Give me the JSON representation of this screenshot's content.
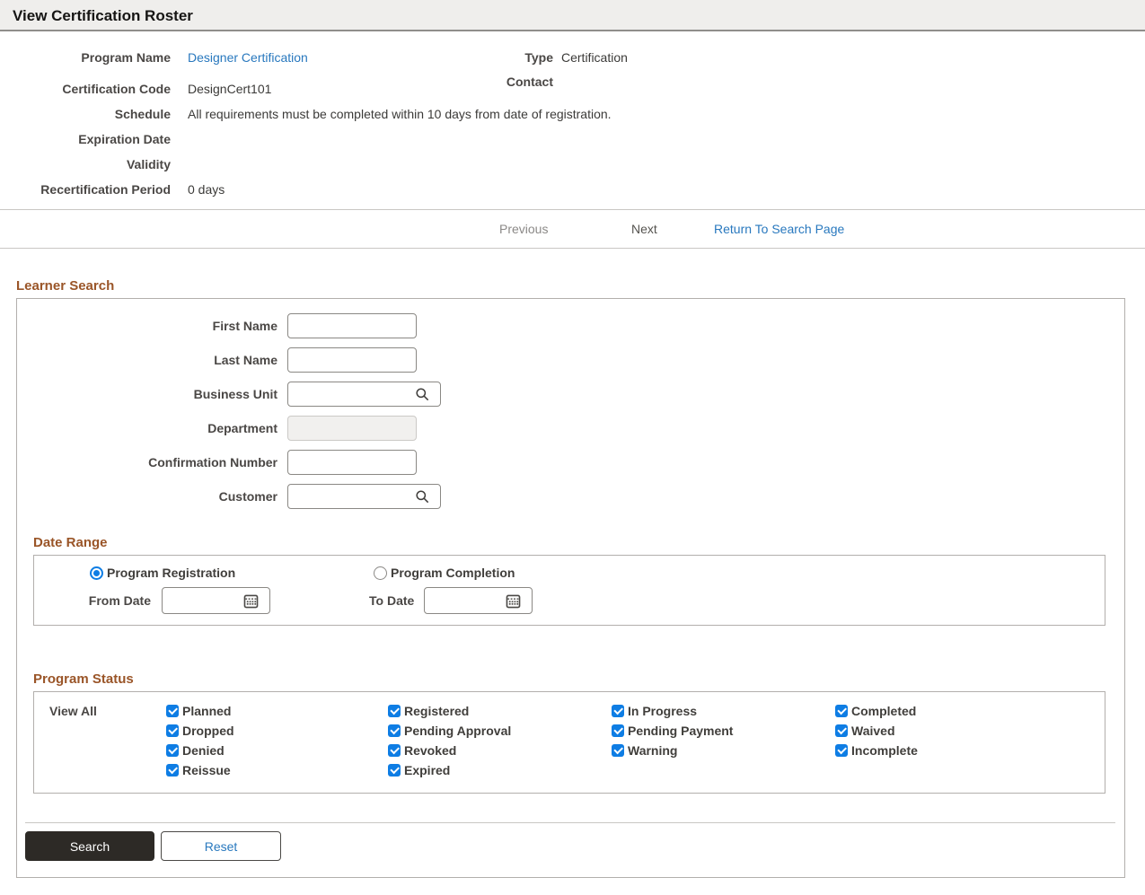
{
  "header": {
    "title": "View Certification Roster"
  },
  "program_info": {
    "left": [
      {
        "label": "Program Name",
        "value": "Designer Certification"
      },
      {
        "label": "Certification Code",
        "value": "DesignCert101"
      },
      {
        "label": "Schedule",
        "value": "All requirements must be completed within 10 days from date of registration."
      },
      {
        "label": "Expiration Date",
        "value": ""
      },
      {
        "label": "Validity",
        "value": ""
      },
      {
        "label": "Recertification Period",
        "value": "0 days"
      }
    ],
    "right": [
      {
        "label": "Type",
        "value": "Certification"
      },
      {
        "label": "Contact",
        "value": ""
      }
    ]
  },
  "nav": {
    "previous": "Previous",
    "next": "Next",
    "return_link": "Return To Search Page"
  },
  "learner_search": {
    "heading": "Learner Search",
    "fields": [
      {
        "label": "First Name",
        "type": "text",
        "value": ""
      },
      {
        "label": "Last Name",
        "type": "text",
        "value": ""
      },
      {
        "label": "Business Unit",
        "type": "lookup",
        "value": ""
      },
      {
        "label": "Department",
        "type": "disabled",
        "value": ""
      },
      {
        "label": "Confirmation Number",
        "type": "text",
        "value": ""
      },
      {
        "label": "Customer",
        "type": "lookup",
        "value": ""
      }
    ]
  },
  "date_range": {
    "heading": "Date Range",
    "radios": [
      {
        "label": "Program Registration",
        "selected": true
      },
      {
        "label": "Program Completion",
        "selected": false
      }
    ],
    "from_label": "From Date",
    "from_value": "",
    "to_label": "To Date",
    "to_value": ""
  },
  "program_status": {
    "heading": "Program Status",
    "view_all_label": "View All",
    "checkboxes": [
      {
        "label": "Planned",
        "checked": true
      },
      {
        "label": "Registered",
        "checked": true
      },
      {
        "label": "In Progress",
        "checked": true
      },
      {
        "label": "Completed",
        "checked": true
      },
      {
        "label": "Dropped",
        "checked": true
      },
      {
        "label": "Pending Approval",
        "checked": true
      },
      {
        "label": "Pending Payment",
        "checked": true
      },
      {
        "label": "Waived",
        "checked": true
      },
      {
        "label": "Denied",
        "checked": true
      },
      {
        "label": "Revoked",
        "checked": true
      },
      {
        "label": "Warning",
        "checked": true
      },
      {
        "label": "Incomplete",
        "checked": true
      },
      {
        "label": "Reissue",
        "checked": true
      },
      {
        "label": "Expired",
        "checked": true
      }
    ]
  },
  "actions": {
    "search": "Search",
    "reset": "Reset"
  },
  "colors": {
    "link_blue": "#2878be",
    "heading_brown": "#9a5528",
    "checkbox_blue": "#0e7de4",
    "button_dark": "#2d2a26",
    "header_bg": "#efeeec"
  }
}
